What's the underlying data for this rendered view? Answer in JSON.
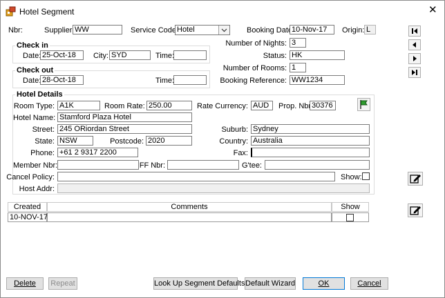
{
  "window": {
    "title": "Hotel Segment",
    "close_glyph": "✕"
  },
  "header": {
    "nbr_label": "Nbr:",
    "supplier_label": "Supplier:",
    "supplier_value": "WW",
    "service_code_label": "Service Code:",
    "service_code_value": "Hotel",
    "booking_date_label": "Booking Date:",
    "booking_date_value": "10-Nov-17",
    "origin_label": "Origin:",
    "origin_value": "L"
  },
  "check_in": {
    "title": "Check in",
    "date_label": "Date:",
    "date_value": "25-Oct-18",
    "city_label": "City:",
    "city_value": "SYD",
    "time_label": "Time:",
    "time_value": ""
  },
  "check_out": {
    "title": "Check out",
    "date_label": "Date:",
    "date_value": "28-Oct-18",
    "time_label": "Time:",
    "time_value": ""
  },
  "right_info": {
    "nights_label": "Number of Nights:",
    "nights_value": "3",
    "status_label": "Status:",
    "status_value": "HK",
    "rooms_label": "Number of Rooms:",
    "rooms_value": "1",
    "booking_ref_label": "Booking Reference:",
    "booking_ref_value": "WW1234"
  },
  "hotel": {
    "title": "Hotel Details",
    "room_type_label": "Room Type:",
    "room_type_value": "A1K",
    "room_rate_label": "Room Rate:",
    "room_rate_value": "250.00",
    "rate_currency_label": "Rate Currency:",
    "rate_currency_value": "AUD",
    "prop_nbr_label": "Prop. Nbr:",
    "prop_nbr_value": "30376",
    "hotel_name_label": "Hotel Name:",
    "hotel_name_value": "Stamford Plaza Hotel",
    "street_label": "Street:",
    "street_value": "245 ORiordan Street",
    "suburb_label": "Suburb:",
    "suburb_value": "Sydney",
    "state_label": "State:",
    "state_value": "NSW",
    "postcode_label": "Postcode:",
    "postcode_value": "2020",
    "country_label": "Country:",
    "country_value": "Australia",
    "phone_label": "Phone:",
    "phone_value": "+61 2 9317 2200",
    "fax_label": "Fax:",
    "fax_value": "",
    "member_label": "Member Nbr:",
    "member_value": "",
    "ff_label": "FF Nbr:",
    "ff_value": "",
    "gtee_label": "G'tee:",
    "gtee_value": "",
    "cancel_label": "Cancel Policy:",
    "cancel_value": "",
    "show_label": "Show:",
    "host_label": "Host Addr:",
    "host_value": ""
  },
  "comments": {
    "col_created": "Created",
    "col_comments": "Comments",
    "col_show": "Show",
    "rows": [
      {
        "created": "10-NOV-17",
        "comments": ""
      }
    ]
  },
  "footer": {
    "delete": "Delete",
    "repeat": "Repeat",
    "lookup": "Look Up Segment Defaults",
    "wizard": "Default Wizard",
    "ok": "OK",
    "cancel": "Cancel"
  },
  "colors": {
    "accent": "#0078d7",
    "nav_icon": "#000000",
    "flag": "#2e9c2e"
  }
}
